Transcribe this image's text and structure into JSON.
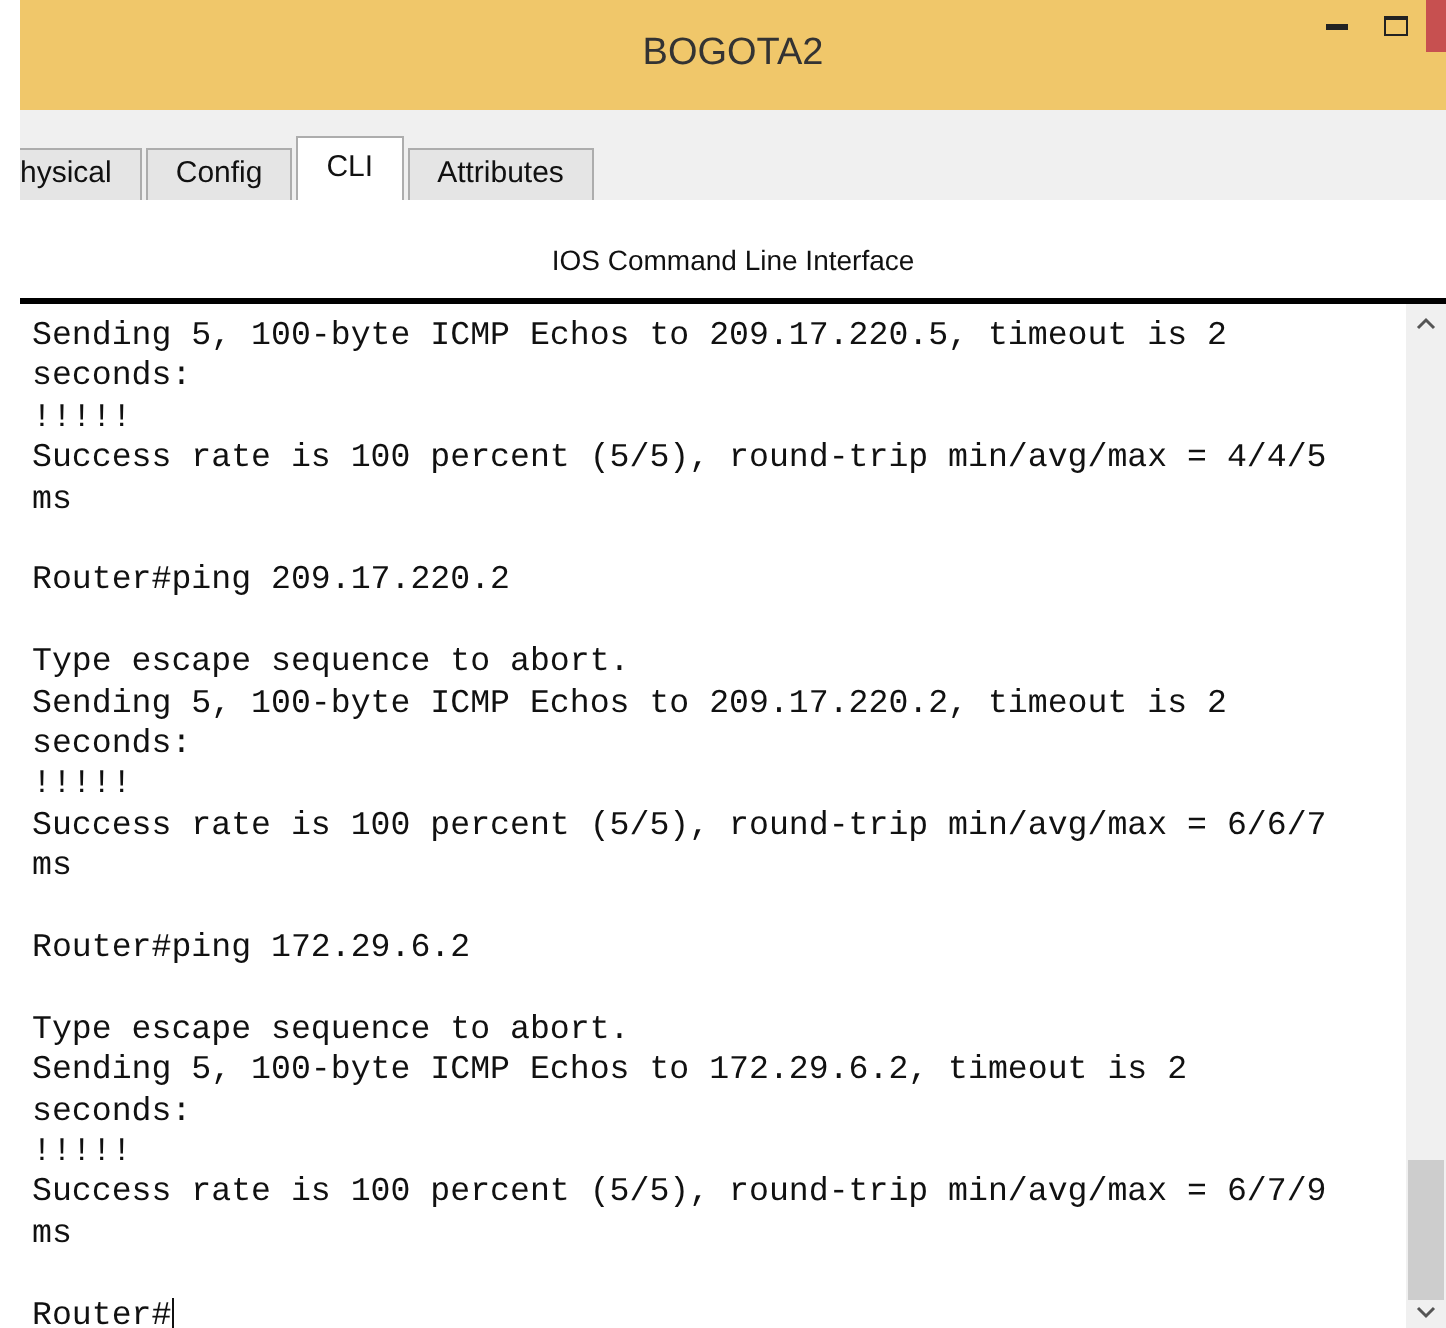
{
  "window": {
    "title": "BOGOTA2"
  },
  "tabs": [
    {
      "label": "hysical",
      "selected": false
    },
    {
      "label": "Config",
      "selected": false
    },
    {
      "label": "CLI",
      "selected": true
    },
    {
      "label": "Attributes",
      "selected": false
    }
  ],
  "panel_title": "IOS Command Line Interface",
  "terminal": {
    "blocks": [
      {
        "lines": [
          "Sending 5, 100-byte ICMP Echos to 209.17.220.5, timeout is 2",
          "seconds:",
          "!!!!!",
          "Success rate is 100 percent (5/5), round-trip min/avg/max = 4/4/5",
          "ms"
        ]
      },
      {
        "lines": [
          "Router#ping 209.17.220.2"
        ]
      },
      {
        "lines": [
          "Type escape sequence to abort.",
          "Sending 5, 100-byte ICMP Echos to 209.17.220.2, timeout is 2",
          "seconds:",
          "!!!!!",
          "Success rate is 100 percent (5/5), round-trip min/avg/max = 6/6/7",
          "ms"
        ]
      },
      {
        "lines": [
          "Router#ping 172.29.6.2"
        ]
      },
      {
        "lines": [
          "Type escape sequence to abort.",
          "Sending 5, 100-byte ICMP Echos to 172.29.6.2, timeout is 2",
          "seconds:",
          "!!!!!",
          "Success rate is 100 percent (5/5), round-trip min/avg/max = 6/7/9",
          "ms"
        ]
      },
      {
        "lines": [
          "Router#"
        ]
      }
    ]
  }
}
